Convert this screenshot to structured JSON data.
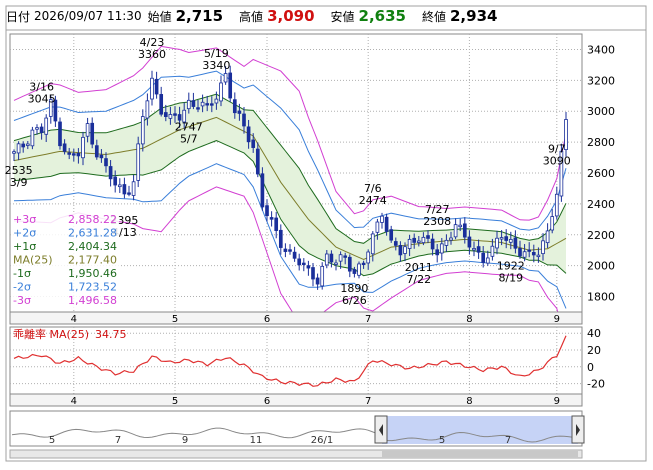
{
  "header": {
    "date_label": "日付",
    "datetime": "2026/09/07 11:30",
    "open_label": "始値",
    "open_value": "2,715",
    "high_label": "高値",
    "high_value": "3,090",
    "low_label": "安値",
    "low_value": "2,635",
    "close_label": "終値",
    "close_value": "2,934"
  },
  "colors": {
    "up": "#ffffff",
    "down": "#1a2f9a",
    "ma": "#7d7d2a",
    "sigma1": "#1e6b1e",
    "sigma2": "#3a7fd9",
    "sigma3": "#d23fd2",
    "deviation": "#e03030",
    "grid": "#b0b0b0",
    "band_fill": "#e4f2dc"
  },
  "legend": [
    {
      "label": "+3σ",
      "value": "2,858.22",
      "color": "#d23fd2"
    },
    {
      "label": "+2σ",
      "value": "2,631.28",
      "color": "#3a7fd9"
    },
    {
      "label": "+1σ",
      "value": "2,404.34",
      "color": "#1e6b1e"
    },
    {
      "label": "MA(25)",
      "value": "2,177.40",
      "color": "#7d7d2a"
    },
    {
      "label": "-1σ",
      "value": "1,950.46",
      "color": "#1e6b1e"
    },
    {
      "label": "-2σ",
      "value": "1,723.52",
      "color": "#3a7fd9"
    },
    {
      "label": "-3σ",
      "value": "1,496.58",
      "color": "#d23fd2"
    }
  ],
  "sub_label": "乖離率 MA(25)",
  "sub_value": "34.75",
  "nav_labels": [
    "5",
    "7",
    "9",
    "11",
    "26/1",
    "5",
    "7"
  ],
  "chart_data": {
    "type": "candlestick",
    "ylim": [
      1700,
      3500
    ],
    "yticks": [
      1800,
      2000,
      2200,
      2400,
      2600,
      2800,
      3000,
      3200,
      3400
    ],
    "x_tick_labels": [
      "4",
      "5",
      "6",
      "7",
      "8",
      "9"
    ],
    "x_tick_positions": [
      13,
      35,
      55,
      77,
      99,
      118
    ],
    "candles_key_points": [
      [
        0,
        2720
      ],
      [
        2,
        2780
      ],
      [
        4,
        2880
      ],
      [
        6,
        2870
      ],
      [
        8,
        3040
      ],
      [
        10,
        2820
      ],
      [
        12,
        2700
      ],
      [
        14,
        2720
      ],
      [
        16,
        2900
      ],
      [
        18,
        2740
      ],
      [
        20,
        2620
      ],
      [
        22,
        2520
      ],
      [
        24,
        2480
      ],
      [
        26,
        2540
      ],
      [
        28,
        2960
      ],
      [
        30,
        3200
      ],
      [
        32,
        3020
      ],
      [
        34,
        2940
      ],
      [
        36,
        2960
      ],
      [
        38,
        3060
      ],
      [
        40,
        3050
      ],
      [
        42,
        3010
      ],
      [
        44,
        3100
      ],
      [
        46,
        3250
      ],
      [
        48,
        2980
      ],
      [
        50,
        2900
      ],
      [
        52,
        2770
      ],
      [
        54,
        2400
      ],
      [
        56,
        2260
      ],
      [
        58,
        2150
      ],
      [
        60,
        2080
      ],
      [
        62,
        2020
      ],
      [
        64,
        1950
      ],
      [
        66,
        1920
      ],
      [
        68,
        2060
      ],
      [
        70,
        2010
      ],
      [
        72,
        2060
      ],
      [
        74,
        1960
      ],
      [
        76,
        2010
      ],
      [
        78,
        2180
      ],
      [
        80,
        2360
      ],
      [
        82,
        2140
      ],
      [
        84,
        2080
      ],
      [
        86,
        2150
      ],
      [
        88,
        2200
      ],
      [
        90,
        2140
      ],
      [
        92,
        2080
      ],
      [
        94,
        2170
      ],
      [
        96,
        2270
      ],
      [
        98,
        2170
      ],
      [
        100,
        2110
      ],
      [
        102,
        2050
      ],
      [
        104,
        2090
      ],
      [
        106,
        2200
      ],
      [
        108,
        2160
      ],
      [
        110,
        2090
      ],
      [
        112,
        2050
      ],
      [
        114,
        2100
      ],
      [
        116,
        2220
      ],
      [
        118,
        2460
      ],
      [
        120,
        2934
      ]
    ],
    "ma_key_points": [
      [
        0,
        2680
      ],
      [
        10,
        2740
      ],
      [
        20,
        2720
      ],
      [
        28,
        2760
      ],
      [
        36,
        2880
      ],
      [
        44,
        2960
      ],
      [
        52,
        2840
      ],
      [
        58,
        2540
      ],
      [
        64,
        2300
      ],
      [
        70,
        2120
      ],
      [
        76,
        2040
      ],
      [
        82,
        2120
      ],
      [
        90,
        2150
      ],
      [
        98,
        2170
      ],
      [
        106,
        2150
      ],
      [
        112,
        2100
      ],
      [
        116,
        2110
      ],
      [
        120,
        2177
      ]
    ],
    "sigma_key_points": [
      [
        0,
        130
      ],
      [
        8,
        150
      ],
      [
        14,
        130
      ],
      [
        20,
        140
      ],
      [
        26,
        160
      ],
      [
        32,
        200
      ],
      [
        38,
        160
      ],
      [
        44,
        150
      ],
      [
        50,
        140
      ],
      [
        54,
        190
      ],
      [
        58,
        240
      ],
      [
        62,
        250
      ],
      [
        66,
        190
      ],
      [
        70,
        120
      ],
      [
        74,
        90
      ],
      [
        78,
        120
      ],
      [
        82,
        110
      ],
      [
        88,
        80
      ],
      [
        94,
        70
      ],
      [
        100,
        70
      ],
      [
        106,
        70
      ],
      [
        110,
        60
      ],
      [
        114,
        70
      ],
      [
        118,
        140
      ],
      [
        120,
        227
      ]
    ],
    "annotations": [
      {
        "text": "3/16",
        "value": "3045",
        "index": 6
      },
      {
        "text": "4/23",
        "value": "3360",
        "index": 30
      },
      {
        "text": "5/19",
        "value": "3340",
        "index": 44
      },
      {
        "text": "2747",
        "value": "5/7",
        "index": 38
      },
      {
        "text": "2535",
        "value": "3/9",
        "index": 1
      },
      {
        "text": "2395",
        "value": "4/13",
        "index": 24
      },
      {
        "text": "7/6",
        "value": "2474",
        "index": 78
      },
      {
        "text": "7/27",
        "value": "2308",
        "index": 92
      },
      {
        "text": "2011",
        "value": "7/22",
        "index": 88
      },
      {
        "text": "1890",
        "value": "6/26",
        "index": 74
      },
      {
        "text": "1922",
        "value": "8/19",
        "index": 108
      },
      {
        "text": "9/7",
        "value": "3090",
        "index": 118
      }
    ],
    "deviation": {
      "ylim": [
        -30,
        45
      ],
      "yticks": [
        40,
        20,
        0,
        -20
      ],
      "key_points": [
        [
          0,
          10
        ],
        [
          6,
          14
        ],
        [
          10,
          4
        ],
        [
          14,
          10
        ],
        [
          18,
          0
        ],
        [
          22,
          -8
        ],
        [
          26,
          -5
        ],
        [
          30,
          12
        ],
        [
          34,
          5
        ],
        [
          38,
          8
        ],
        [
          42,
          3
        ],
        [
          46,
          11
        ],
        [
          50,
          2
        ],
        [
          54,
          -12
        ],
        [
          58,
          -18
        ],
        [
          62,
          -20
        ],
        [
          66,
          -22
        ],
        [
          70,
          -15
        ],
        [
          74,
          -18
        ],
        [
          78,
          8
        ],
        [
          82,
          3
        ],
        [
          86,
          -2
        ],
        [
          90,
          2
        ],
        [
          94,
          6
        ],
        [
          98,
          1
        ],
        [
          102,
          -4
        ],
        [
          106,
          0
        ],
        [
          110,
          -12
        ],
        [
          114,
          -4
        ],
        [
          118,
          14
        ],
        [
          120,
          35
        ]
      ]
    }
  }
}
